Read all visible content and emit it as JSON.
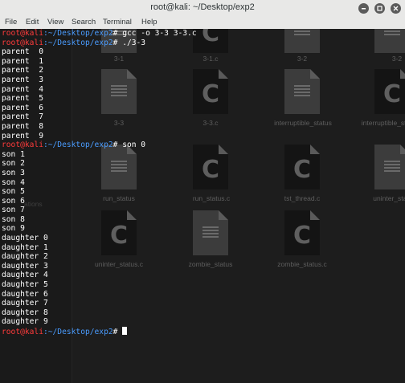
{
  "window": {
    "title": "root@kali: ~/Desktop/exp2",
    "menu": [
      "File",
      "Edit",
      "View",
      "Search",
      "Terminal",
      "Help"
    ]
  },
  "background_files": [
    {
      "name": "3-1",
      "kind": "exec"
    },
    {
      "name": "3-1.c",
      "kind": "source"
    },
    {
      "name": "3-2",
      "kind": "exec"
    },
    {
      "name": "3-2",
      "kind": "exec"
    },
    {
      "name": "3-3",
      "kind": "exec"
    },
    {
      "name": "3-3.c",
      "kind": "source"
    },
    {
      "name": "interruptible_status",
      "kind": "exec"
    },
    {
      "name": "interruptible_status.c",
      "kind": "source"
    },
    {
      "name": "run_status",
      "kind": "exec"
    },
    {
      "name": "run_status.c",
      "kind": "source"
    },
    {
      "name": "tst_thread.c",
      "kind": "source"
    },
    {
      "name": "uninter_status",
      "kind": "exec"
    },
    {
      "name": "uninter_status.c",
      "kind": "source"
    },
    {
      "name": "zombie_status",
      "kind": "exec"
    },
    {
      "name": "zombie_status.c",
      "kind": "source"
    }
  ],
  "sidebar_ghost_label": "ations",
  "terminal": {
    "prompt_user": "root@kali",
    "prompt_path": ":~/Desktop/exp2",
    "prompt_symbol": "# ",
    "commands": [
      "gcc -o 3-3 3-3.c",
      "./3-3",
      "son 0",
      ""
    ],
    "output_parent": [
      "parent  0",
      "parent  1",
      "parent  2",
      "parent  3",
      "parent  4",
      "parent  5",
      "parent  6",
      "parent  7",
      "parent  8",
      "parent  9"
    ],
    "output_son": [
      "son 1",
      "son 2",
      "son 3",
      "son 4",
      "son 5",
      "son 6",
      "son 7",
      "son 8",
      "son 9",
      "daughter 0",
      "daughter 1",
      "daughter 2",
      "daughter 3",
      "daughter 4",
      "daughter 5",
      "daughter 6",
      "daughter 7",
      "daughter 8",
      "daughter 9"
    ]
  }
}
